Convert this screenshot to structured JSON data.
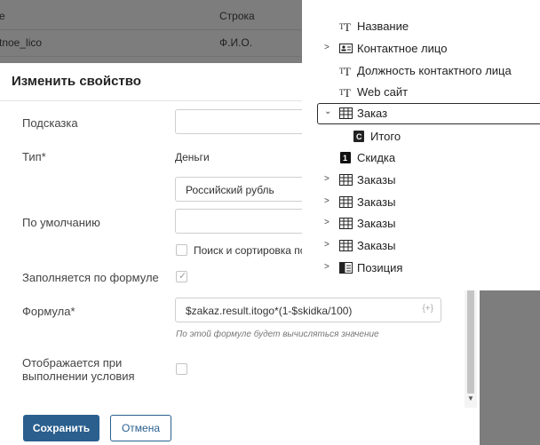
{
  "background_table": {
    "headers": [
      "e",
      "Строка"
    ],
    "row": [
      "tnoe_lico",
      "Ф.И.О."
    ]
  },
  "modal": {
    "title": "Изменить свойство",
    "fields": {
      "hint_label": "Подсказка",
      "type_label": "Тип*",
      "type_value": "Деньги",
      "currency_value": "Российский рубль",
      "default_label": "По умолчанию",
      "search_sort_label": "Поиск и сортировка по",
      "formula_filled_label": "Заполняется по формуле",
      "formula_label": "Формула*",
      "formula_value": "$zakaz.result.itogo*(1-$skidka/100)",
      "formula_hint": "По этой формуле будет вычисляться значение",
      "condition_label_line1": "Отображается при",
      "condition_label_line2": "выполнении условия"
    },
    "buttons": {
      "save": "Сохранить",
      "cancel": "Отмена"
    }
  },
  "tree": {
    "items": [
      {
        "label": "Название",
        "icon": "text-icon",
        "expandable": false,
        "level": 0
      },
      {
        "label": "Контактное лицо",
        "icon": "contact-card-icon",
        "expandable": true,
        "level": 0
      },
      {
        "label": "Должность контактного лица",
        "icon": "text-icon",
        "expandable": false,
        "level": 0
      },
      {
        "label": "Web сайт",
        "icon": "text-icon",
        "expandable": false,
        "level": 0
      },
      {
        "label": "Заказ",
        "icon": "table-icon",
        "expandable": true,
        "expanded": true,
        "selected": true,
        "level": 0
      },
      {
        "label": "Итого",
        "icon": "currency-icon",
        "expandable": false,
        "level": 1
      },
      {
        "label": "Скидка",
        "icon": "number-icon",
        "expandable": false,
        "level": 0
      },
      {
        "label": "Заказы",
        "icon": "table-icon",
        "expandable": true,
        "level": 0
      },
      {
        "label": "Заказы",
        "icon": "table-icon",
        "expandable": true,
        "level": 0
      },
      {
        "label": "Заказы",
        "icon": "table-icon",
        "expandable": true,
        "level": 0
      },
      {
        "label": "Заказы",
        "icon": "table-icon",
        "expandable": true,
        "level": 0
      },
      {
        "label": "Позиция",
        "icon": "document-icon",
        "expandable": true,
        "level": 0
      }
    ]
  },
  "formula_insert_icon": "{+}",
  "colors": {
    "primary": "#2a5f8e",
    "overlay": "#7d7d7d"
  }
}
